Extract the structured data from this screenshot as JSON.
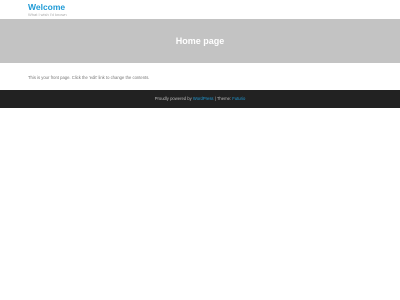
{
  "header": {
    "site_title": "Welcome",
    "tagline": "What I wish I'd known"
  },
  "hero": {
    "title": "Home page"
  },
  "content": {
    "text": "This is your front page. Click the 'edit' link to change the contents."
  },
  "footer": {
    "prefix": "Proudly powered by",
    "wordpress_link": "WordPress",
    "separator": " | Theme: ",
    "theme_link": "Futurio"
  },
  "colors": {
    "accent": "#1e9ad6",
    "hero_bg": "#c3c3c3",
    "footer_bg": "#222222"
  }
}
